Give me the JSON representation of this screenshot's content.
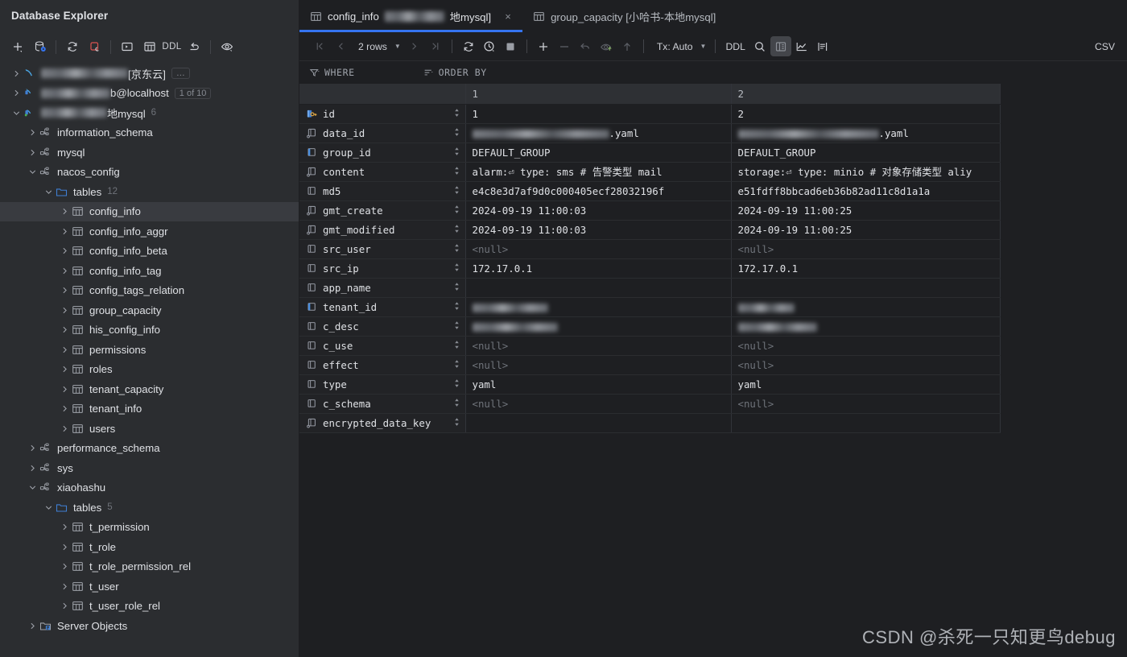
{
  "sidebar": {
    "title": "Database Explorer",
    "toolbar": [
      {
        "name": "add-icon",
        "label": "+"
      },
      {
        "name": "database-settings-icon",
        "label": ""
      },
      {
        "name": "refresh-icon",
        "label": ""
      },
      {
        "name": "stop-refresh-icon",
        "label": ""
      },
      {
        "name": "console-icon",
        "label": ""
      },
      {
        "name": "table-icon",
        "label": ""
      },
      {
        "name": "ddl-button",
        "label": "DDL"
      },
      {
        "name": "jump-to-icon",
        "label": ""
      },
      {
        "name": "preview-icon",
        "label": ""
      }
    ],
    "tree": [
      {
        "indent": 0,
        "arrow": "right",
        "icon": "datasource-redacted-icon",
        "redacted": 108,
        "label": " [京东云]",
        "badge": "…",
        "badge_style": "box",
        "selected": false
      },
      {
        "indent": 0,
        "arrow": "right",
        "icon": "datasource-mysql-icon",
        "redacted": 86,
        "label": "b@localhost",
        "badge": "1 of 10",
        "badge_style": "box",
        "selected": false
      },
      {
        "indent": 0,
        "arrow": "down",
        "icon": "datasource-mysql-connected-icon",
        "redacted": 82,
        "label": "地mysql",
        "badge": "6",
        "badge_style": "plain",
        "selected": false
      },
      {
        "indent": 1,
        "arrow": "right",
        "icon": "schema-icon",
        "label": "information_schema",
        "selected": false
      },
      {
        "indent": 1,
        "arrow": "right",
        "icon": "schema-icon",
        "label": "mysql",
        "selected": false
      },
      {
        "indent": 1,
        "arrow": "down",
        "icon": "schema-icon",
        "label": "nacos_config",
        "selected": false
      },
      {
        "indent": 2,
        "arrow": "down",
        "icon": "folder-icon",
        "label": "tables",
        "badge": "12",
        "badge_style": "plain",
        "selected": false
      },
      {
        "indent": 3,
        "arrow": "right",
        "icon": "table-icon",
        "label": "config_info",
        "selected": true
      },
      {
        "indent": 3,
        "arrow": "right",
        "icon": "table-icon",
        "label": "config_info_aggr",
        "selected": false
      },
      {
        "indent": 3,
        "arrow": "right",
        "icon": "table-icon",
        "label": "config_info_beta",
        "selected": false
      },
      {
        "indent": 3,
        "arrow": "right",
        "icon": "table-icon",
        "label": "config_info_tag",
        "selected": false
      },
      {
        "indent": 3,
        "arrow": "right",
        "icon": "table-icon",
        "label": "config_tags_relation",
        "selected": false
      },
      {
        "indent": 3,
        "arrow": "right",
        "icon": "table-icon",
        "label": "group_capacity",
        "selected": false
      },
      {
        "indent": 3,
        "arrow": "right",
        "icon": "table-icon",
        "label": "his_config_info",
        "selected": false
      },
      {
        "indent": 3,
        "arrow": "right",
        "icon": "table-icon",
        "label": "permissions",
        "selected": false
      },
      {
        "indent": 3,
        "arrow": "right",
        "icon": "table-icon",
        "label": "roles",
        "selected": false
      },
      {
        "indent": 3,
        "arrow": "right",
        "icon": "table-icon",
        "label": "tenant_capacity",
        "selected": false
      },
      {
        "indent": 3,
        "arrow": "right",
        "icon": "table-icon",
        "label": "tenant_info",
        "selected": false
      },
      {
        "indent": 3,
        "arrow": "right",
        "icon": "table-icon",
        "label": "users",
        "selected": false
      },
      {
        "indent": 1,
        "arrow": "right",
        "icon": "schema-icon",
        "label": "performance_schema",
        "selected": false
      },
      {
        "indent": 1,
        "arrow": "right",
        "icon": "schema-icon",
        "label": "sys",
        "selected": false
      },
      {
        "indent": 1,
        "arrow": "down",
        "icon": "schema-icon",
        "label": "xiaohashu",
        "selected": false
      },
      {
        "indent": 2,
        "arrow": "down",
        "icon": "folder-icon",
        "label": "tables",
        "badge": "5",
        "badge_style": "plain",
        "selected": false
      },
      {
        "indent": 3,
        "arrow": "right",
        "icon": "table-icon",
        "label": "t_permission",
        "selected": false
      },
      {
        "indent": 3,
        "arrow": "right",
        "icon": "table-icon",
        "label": "t_role",
        "selected": false
      },
      {
        "indent": 3,
        "arrow": "right",
        "icon": "table-icon",
        "label": "t_role_permission_rel",
        "selected": false
      },
      {
        "indent": 3,
        "arrow": "right",
        "icon": "table-icon",
        "label": "t_user",
        "selected": false
      },
      {
        "indent": 3,
        "arrow": "right",
        "icon": "table-icon",
        "label": "t_user_role_rel",
        "selected": false
      },
      {
        "indent": 1,
        "arrow": "right",
        "icon": "server-objects-icon",
        "label": "Server Objects",
        "selected": false
      }
    ]
  },
  "tabs": [
    {
      "icon": "table-icon",
      "label_prefix": "config_info ",
      "redacted": 74,
      "label_suffix": "地mysql]",
      "active": true,
      "closable": true
    },
    {
      "icon": "table-icon",
      "label": "group_capacity [小哈书-本地mysql]",
      "active": false,
      "closable": false
    }
  ],
  "gridbar": {
    "first_page": "⏮",
    "prev_page": "‹",
    "rows_label": "2 rows",
    "next_page": "›",
    "last_page": "⏭",
    "reload": "reload-icon",
    "history": "history-icon",
    "stop": "stop-icon",
    "add_row": "+",
    "remove_row": "−",
    "revert": "revert-icon",
    "submit": "submit-icon",
    "upload": "upload-icon",
    "tx_label": "Tx: Auto",
    "ddl_label": "DDL",
    "search": "search-icon",
    "transpose": "transpose-view-icon",
    "chart": "chart-icon",
    "value_editor": "value-editor-icon",
    "csv_label": "CSV"
  },
  "filters": {
    "where": "WHERE",
    "order_by": "ORDER BY"
  },
  "table": {
    "headers": [
      "",
      "1",
      "2"
    ],
    "rows": [
      {
        "name": "id",
        "icon": "column-pk-icon",
        "v1": "1",
        "v2": "2"
      },
      {
        "name": "data_id",
        "icon": "column-text-icon",
        "v1_redacted": 170,
        "v1": ".yaml",
        "v2_redacted": 175,
        "v2": ".yaml"
      },
      {
        "name": "group_id",
        "icon": "column-indexed-icon",
        "v1": "DEFAULT_GROUP",
        "v2": "DEFAULT_GROUP"
      },
      {
        "name": "content",
        "icon": "column-text-icon",
        "v1": "alarm:⏎  type: sms # 告警类型 mail",
        "v2": "storage:⏎  type: minio # 对象存储类型 aliy"
      },
      {
        "name": "md5",
        "icon": "column-plain-icon",
        "v1": "e4c8e3d7af9d0c000405ecf28032196f",
        "v2": "e51fdff8bbcad6eb36b82ad11c8d1a1a"
      },
      {
        "name": "gmt_create",
        "icon": "column-text-icon",
        "v1": "2024-09-19 11:00:03",
        "v2": "2024-09-19 11:00:25"
      },
      {
        "name": "gmt_modified",
        "icon": "column-text-icon",
        "v1": "2024-09-19 11:00:03",
        "v2": "2024-09-19 11:00:25"
      },
      {
        "name": "src_user",
        "icon": "column-plain-icon",
        "v1": "<null>",
        "v1_null": true,
        "v2": "<null>",
        "v2_null": true
      },
      {
        "name": "src_ip",
        "icon": "column-plain-icon",
        "v1": "172.17.0.1",
        "v2": "172.17.0.1"
      },
      {
        "name": "app_name",
        "icon": "column-plain-icon",
        "v1": "",
        "v2": ""
      },
      {
        "name": "tenant_id",
        "icon": "column-indexed-icon",
        "v1_redacted": 94,
        "v1": "",
        "v2_redacted": 70,
        "v2": ""
      },
      {
        "name": "c_desc",
        "icon": "column-plain-icon",
        "v1_redacted": 106,
        "v1": "",
        "v2_redacted": 98,
        "v2": ""
      },
      {
        "name": "c_use",
        "icon": "column-plain-icon",
        "v1": "<null>",
        "v1_null": true,
        "v2": "<null>",
        "v2_null": true
      },
      {
        "name": "effect",
        "icon": "column-plain-icon",
        "v1": "<null>",
        "v1_null": true,
        "v2": "<null>",
        "v2_null": true
      },
      {
        "name": "type",
        "icon": "column-plain-icon",
        "v1": "yaml",
        "v2": "yaml"
      },
      {
        "name": "c_schema",
        "icon": "column-plain-icon",
        "v1": "<null>",
        "v1_null": true,
        "v2": "<null>",
        "v2_null": true
      },
      {
        "name": "encrypted_data_key",
        "icon": "column-text-icon",
        "v1": "",
        "v2": ""
      }
    ]
  },
  "watermark": "CSDN @杀死一只知更鸟debug",
  "colors": {
    "accent": "#3574f0",
    "bg": "#1e1f22",
    "sidebar_bg": "#2b2d30",
    "selection": "#393b40",
    "pk_gold": "#d9a343",
    "col_blue": "#3f7fd4"
  }
}
